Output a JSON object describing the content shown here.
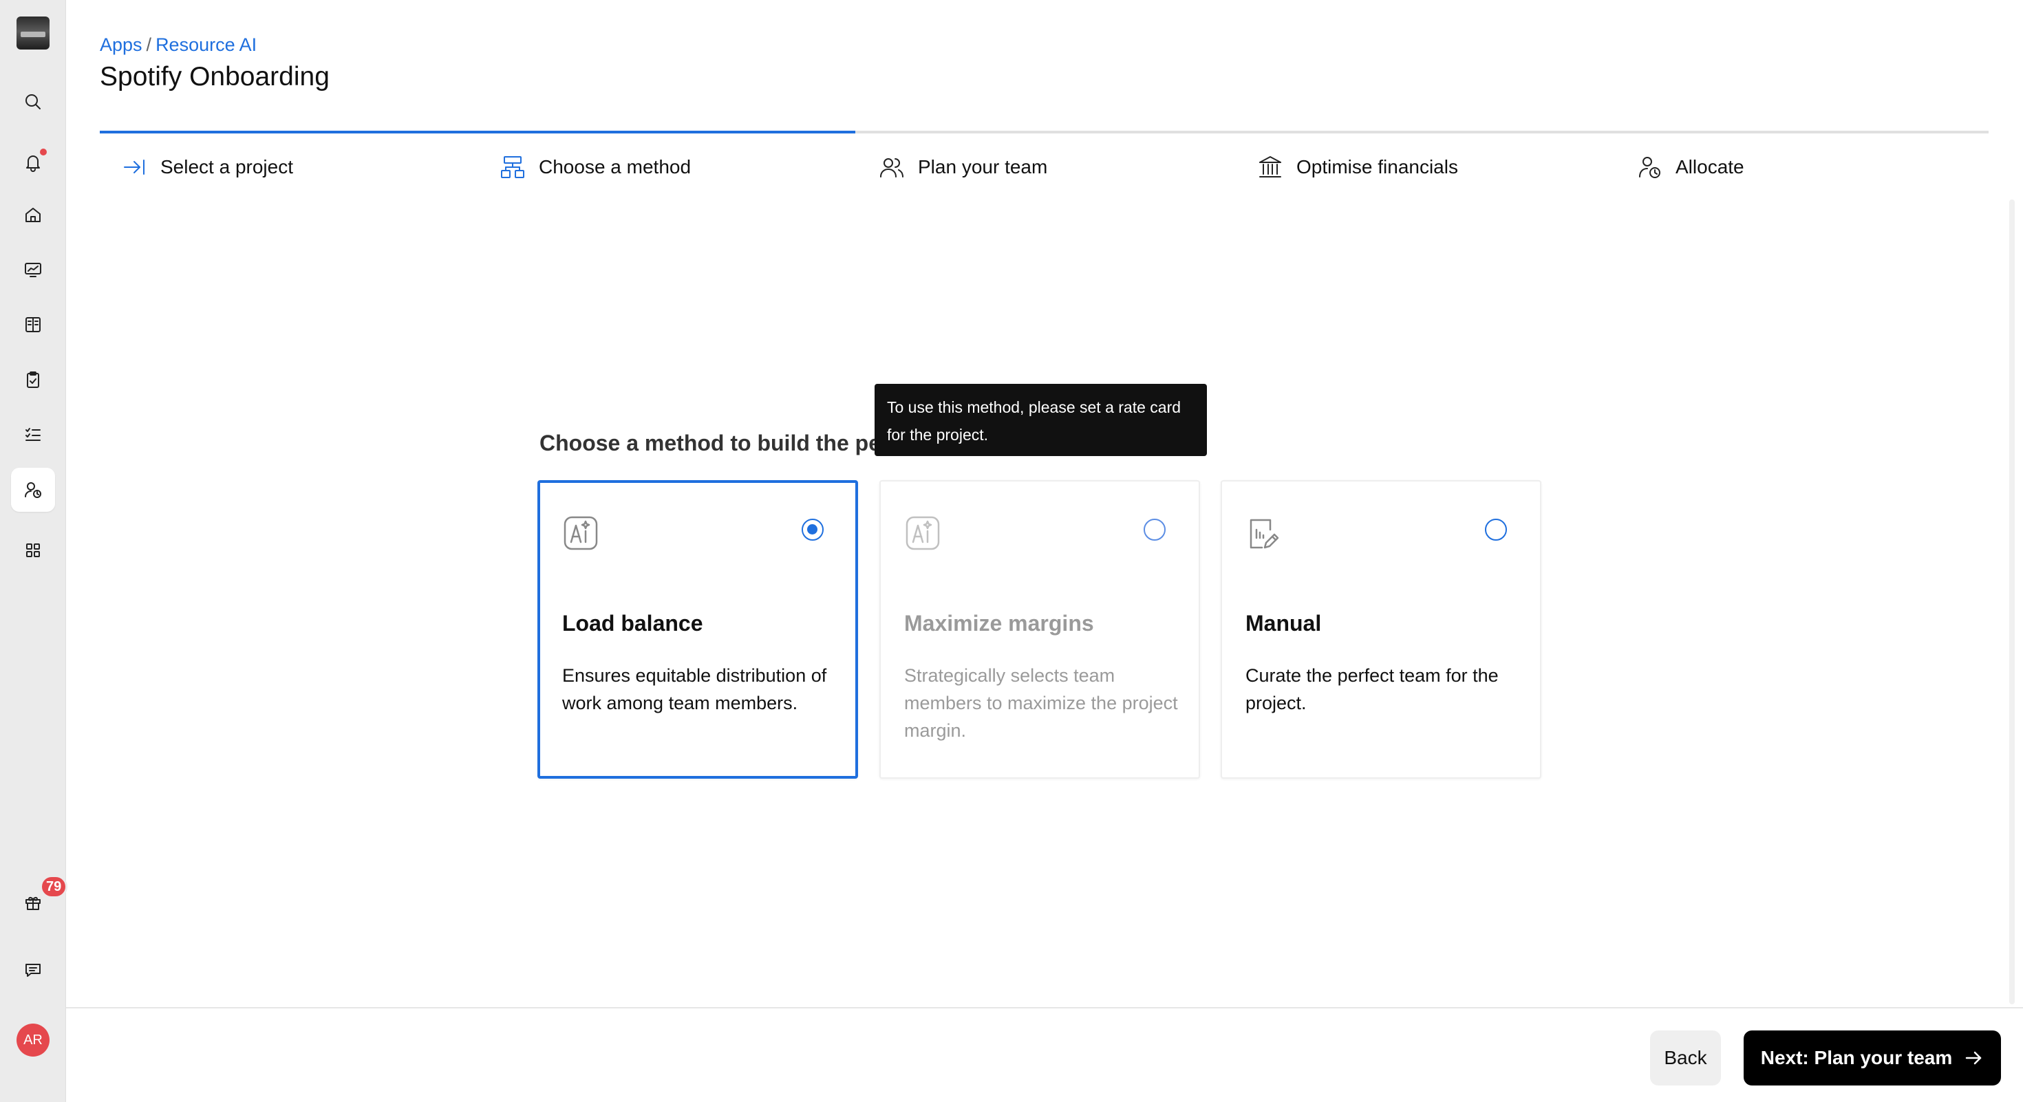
{
  "breadcrumb": {
    "apps": "Apps",
    "separator": "/",
    "current": "Resource AI"
  },
  "page_title": "Spotify Onboarding",
  "stepper": {
    "progress_fraction": 0.4,
    "steps": [
      {
        "label": "Select a project",
        "icon": "arrow-to-line-icon",
        "state": "done"
      },
      {
        "label": "Choose a method",
        "icon": "hierarchy-icon",
        "state": "current"
      },
      {
        "label": "Plan your team",
        "icon": "users-icon",
        "state": "upcoming"
      },
      {
        "label": "Optimise financials",
        "icon": "bank-icon",
        "state": "upcoming"
      },
      {
        "label": "Allocate",
        "icon": "user-clock-icon",
        "state": "upcoming"
      }
    ]
  },
  "method": {
    "heading": "Choose a method to build the pe",
    "tooltip": "To use this method, please set a rate card for the project.",
    "cards": [
      {
        "title": "Load balance",
        "description": "Ensures equitable distribution of work among team members.",
        "selected": true,
        "disabled": false,
        "icon": "ai-icon"
      },
      {
        "title": "Maximize margins",
        "description": "Strategically selects team members to maximize the project margin.",
        "selected": false,
        "disabled": true,
        "icon": "ai-icon"
      },
      {
        "title": "Manual",
        "description": "Curate the perfect team for the project.",
        "selected": false,
        "disabled": false,
        "icon": "document-edit-icon"
      }
    ]
  },
  "sidebar": {
    "notification_count": "79",
    "avatar_initials": "AR",
    "items": [
      "search-icon",
      "bell-icon",
      "home-icon",
      "monitor-chart-icon",
      "book-icon",
      "clipboard-check-icon",
      "task-list-icon",
      "user-clock-icon",
      "apps-icon",
      "gift-icon",
      "chat-icon"
    ]
  },
  "footer": {
    "back_label": "Back",
    "next_label": "Next: Plan your team"
  },
  "colors": {
    "accent": "#1f6fde",
    "badge": "#e5484d",
    "primary_button": "#000000"
  }
}
